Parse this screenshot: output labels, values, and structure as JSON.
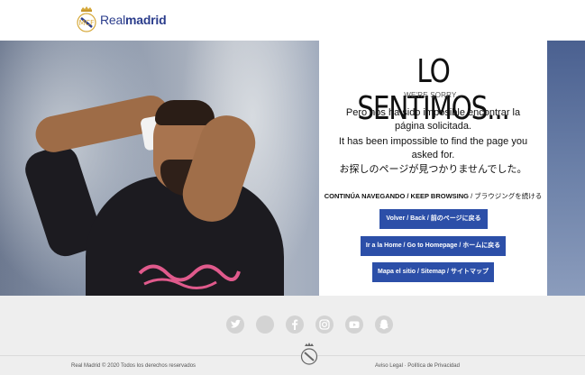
{
  "header": {
    "brand_light": "Real",
    "brand_bold": "madrid"
  },
  "card": {
    "title": "LO SENTIMOS...",
    "subtitle": "WE'RE SORRY...",
    "message_es": "Pero nos ha sido imposible encontrar la página solicitada.",
    "message_en": "It has been impossible to find the page you asked for.",
    "message_ja": "お探しのページが見つかりませんでした。",
    "keep_browsing_bold": "CONTINÚA NAVEGANDO / KEEP BROWSING",
    "keep_browsing_rest": " / ブラウジングを続ける",
    "buttons": {
      "back": "Volver / Back / 前のページに戻る",
      "home": "Ir a la Home / Go to Homepage / ホームに戻る",
      "sitemap": "Mapa el sitio / Sitemap / サイトマップ"
    }
  },
  "footer": {
    "social": [
      "twitter-icon",
      "facebook-icon",
      "facebook-icon",
      "instagram-icon",
      "youtube-icon",
      "snapchat-icon"
    ],
    "copyright": "Real Madrid © 2020 Todos los derechos reservados",
    "legal": "Aviso Legal · Política de Privacidad"
  },
  "colors": {
    "brand_blue": "#2b3d8c",
    "button_blue": "#2c4fa8",
    "footer_bg": "#eeeeee",
    "social_icon": "#d3d3d3"
  }
}
